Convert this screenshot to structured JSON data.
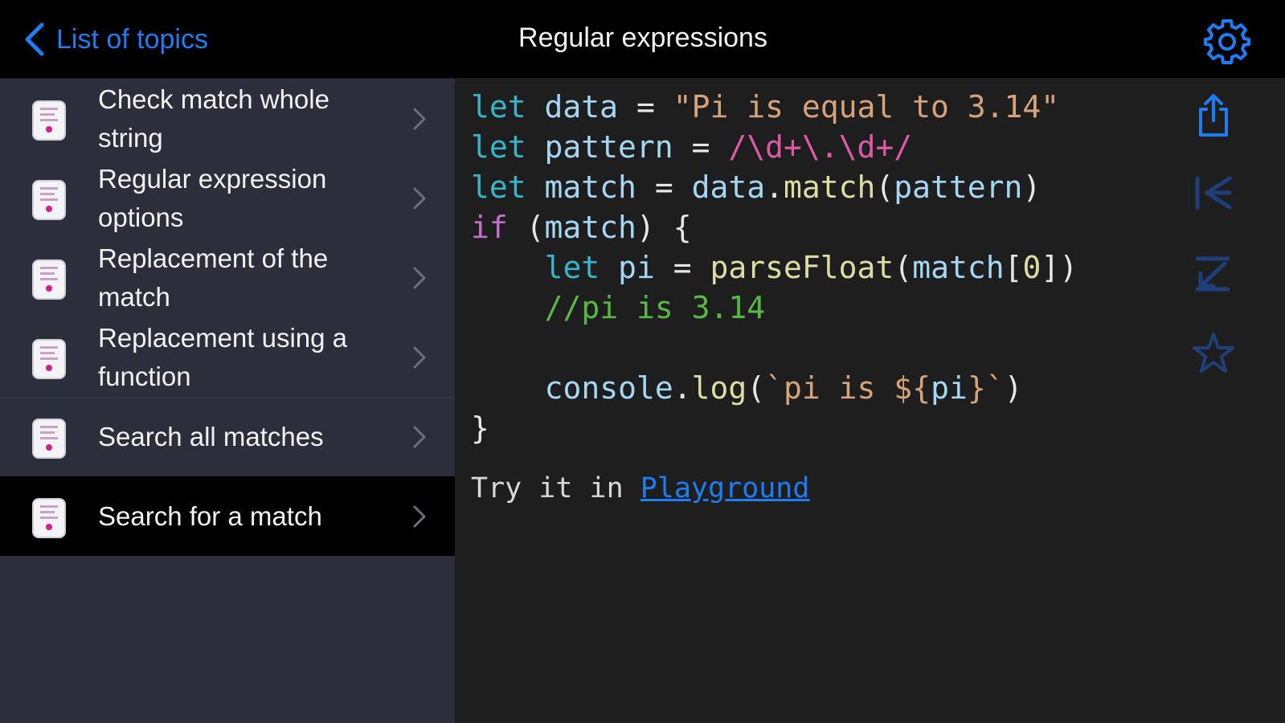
{
  "navbar": {
    "back_label": "List of topics",
    "title": "Regular expressions"
  },
  "sidebar": {
    "items": [
      {
        "label": "Check match whole string",
        "icon": "code-document-icon",
        "selected": false
      },
      {
        "label": "Regular expression options",
        "icon": "code-document-icon",
        "selected": false
      },
      {
        "label": "Replacement of the match",
        "icon": "code-document-icon",
        "selected": false
      },
      {
        "label": "Replacement using a function",
        "icon": "code-document-icon",
        "selected": false
      },
      {
        "label": "Search all matches",
        "icon": "code-document-icon",
        "selected": false
      },
      {
        "label": "Search for a match",
        "icon": "code-document-icon",
        "selected": true
      }
    ]
  },
  "code": {
    "language": "javascript",
    "lines": [
      "let data = \"Pi is equal to 3.14\"",
      "let pattern = /\\d+\\.\\d+/",
      "let match = data.match(pattern)",
      "if (match) {",
      "    let pi = parseFloat(match[0])",
      "    //pi is 3.14",
      "",
      "    console.log(`pi is ${pi}`)",
      "}"
    ]
  },
  "try_it": {
    "prefix": "Try it in ",
    "link": "Playground"
  },
  "toolbar": {
    "buttons": [
      "share-icon",
      "first-icon",
      "last-icon",
      "star-icon"
    ]
  },
  "colors": {
    "accent": "#1f7cf2",
    "sidebar_bg": "#2d2e3c",
    "content_bg": "#1e1e1f",
    "navbar_bg": "#000000",
    "keyword": "#36b5c9",
    "string": "#d6a37b",
    "regex": "#e059a8",
    "comment": "#56ba42"
  }
}
